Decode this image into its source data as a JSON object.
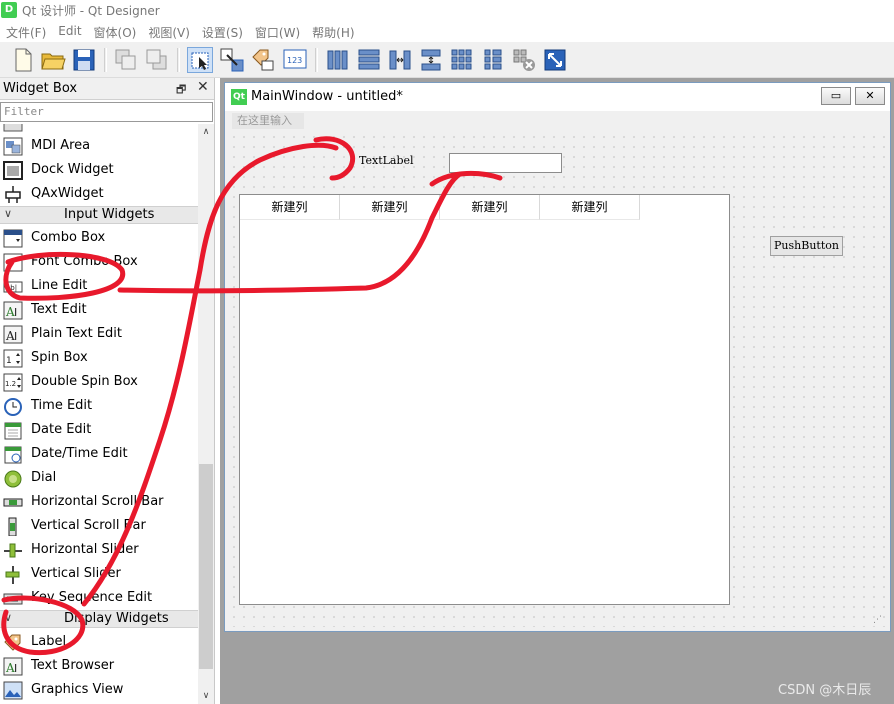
{
  "app": {
    "icon": "qt-designer-icon",
    "title": "Qt 设计师 - Qt Designer"
  },
  "menubar": [
    "文件(F)",
    "Edit",
    "窗体(O)",
    "视图(V)",
    "设置(S)",
    "窗口(W)",
    "帮助(H)"
  ],
  "toolbar_icons": [
    "new-file-icon",
    "open-folder-icon",
    "save-icon",
    "send-to-back-icon",
    "bring-to-front-icon",
    "edit-widgets-icon",
    "edit-signals-slots-icon",
    "edit-buddies-icon",
    "edit-tab-order-icon",
    "layout-horizontal-icon",
    "layout-vertical-icon",
    "layout-horizontal-splitter-icon",
    "layout-vertical-splitter-icon",
    "layout-grid-icon",
    "layout-form-icon",
    "break-layout-icon",
    "adjust-size-icon"
  ],
  "widgetbox": {
    "title": "Widget Box",
    "filter_placeholder": "Filter",
    "float_icon": "float-icon",
    "close_icon": "close-icon",
    "items": {
      "mdi_area": "MDI Area",
      "dock_widget": "Dock Widget",
      "qax_widget": "QAxWidget",
      "combo_box": "Combo Box",
      "font_combo_box": "Font Combo Box",
      "line_edit": "Line Edit",
      "text_edit": "Text Edit",
      "plain_text_edit": "Plain Text Edit",
      "spin_box": "Spin Box",
      "double_spin_box": "Double Spin Box",
      "time_edit": "Time Edit",
      "date_edit": "Date Edit",
      "datetime_edit": "Date/Time Edit",
      "dial": "Dial",
      "h_scroll_bar": "Horizontal Scroll Bar",
      "v_scroll_bar": "Vertical Scroll Bar",
      "h_slider": "Horizontal Slider",
      "v_slider": "Vertical Slider",
      "key_sequence_edit": "Key Sequence Edit",
      "label": "Label",
      "text_browser": "Text Browser",
      "graphics_view": "Graphics View"
    },
    "categories": {
      "input": "Input Widgets",
      "display": "Display Widgets"
    }
  },
  "form_window": {
    "title": "MainWindow - untitled*",
    "menu_placeholder": "在这里输入",
    "minimize": "▭",
    "close": "✕",
    "text_label": "TextLabel",
    "table_headers": [
      "新建列",
      "新建列",
      "新建列",
      "新建列"
    ],
    "push_button": "PushButton"
  },
  "watermark": "CSDN @木日辰",
  "annotation_color": "#e8192c"
}
